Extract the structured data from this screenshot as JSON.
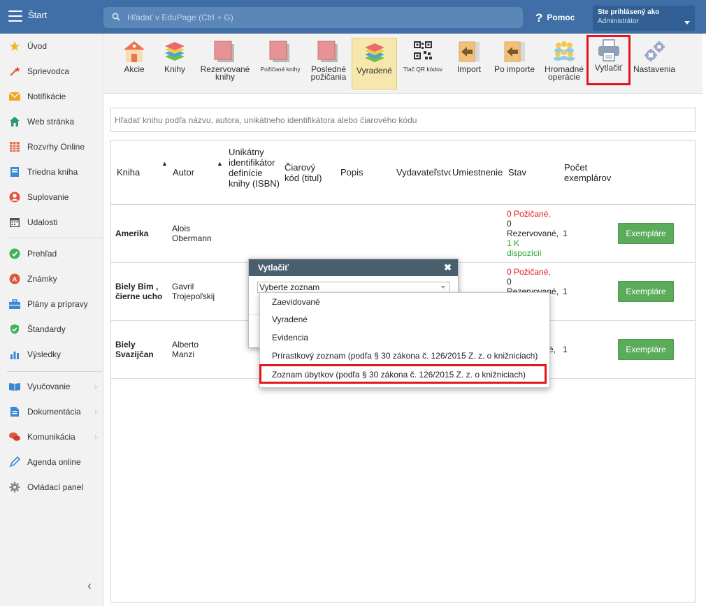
{
  "topbar": {
    "app_title": "Štart",
    "search_placeholder": "Hľadať v EduPage (Ctrl + G)",
    "help_label": "Pomoc",
    "user_line1": "Ste prihlásený ako",
    "user_line2": "Administrátor"
  },
  "sidebar": {
    "items": [
      {
        "label": "Úvod",
        "icon": "star-icon"
      },
      {
        "label": "Sprievodca",
        "icon": "wand-icon"
      },
      {
        "label": "Notifikácie",
        "icon": "envelope-icon"
      },
      {
        "label": "Web stránka",
        "icon": "house-icon"
      },
      {
        "label": "Rozvrhy Online",
        "icon": "timetable-icon"
      },
      {
        "label": "Triedna kniha",
        "icon": "book-icon"
      },
      {
        "label": "Suplovanie",
        "icon": "person-icon"
      },
      {
        "label": "Udalosti",
        "icon": "calendar-icon"
      },
      {
        "label": "Prehľad",
        "icon": "check-circle-icon"
      },
      {
        "label": "Známky",
        "icon": "grade-icon"
      },
      {
        "label": "Plány a prípravy",
        "icon": "briefcase-icon"
      },
      {
        "label": "Štandardy",
        "icon": "shield-icon"
      },
      {
        "label": "Výsledky",
        "icon": "bar-chart-icon"
      },
      {
        "label": "Vyučovanie",
        "icon": "open-book-icon"
      },
      {
        "label": "Dokumentácia",
        "icon": "document-icon"
      },
      {
        "label": "Komunikácia",
        "icon": "chat-icon"
      },
      {
        "label": "Agenda online",
        "icon": "pen-icon"
      },
      {
        "label": "Ovládací panel",
        "icon": "gear-icon"
      }
    ],
    "collapse_label": "‹"
  },
  "toolbar": {
    "items": [
      {
        "label": "Akcie",
        "icon": "building-icon"
      },
      {
        "label": "Knihy",
        "icon": "books-stack-icon"
      },
      {
        "label": "Rezervované knihy",
        "icon": "pink-book-icon"
      },
      {
        "label": "Požičané knihy",
        "icon": "pink-book-icon"
      },
      {
        "label": "Posledné požičania",
        "icon": "pink-book-icon"
      },
      {
        "label": "Vyradené",
        "icon": "books-stack-icon"
      },
      {
        "label": "Tlač QR kódov",
        "icon": "qr-code-icon"
      },
      {
        "label": "Import",
        "icon": "import-arrow-icon"
      },
      {
        "label": "Po importe",
        "icon": "import-arrow-icon"
      },
      {
        "label": "Hromadné operácie",
        "icon": "people-icon"
      },
      {
        "label": "Vytlačiť",
        "icon": "printer-icon"
      },
      {
        "label": "Nastavenia",
        "icon": "gears-icon"
      }
    ]
  },
  "book_search": {
    "placeholder": "Hľadať knihu podľa názvu, autora, unikátneho identifikátora alebo čiarového kódu"
  },
  "table": {
    "headers": {
      "kniha": "Kniha",
      "autor": "Autor",
      "isbn": "Unikátny identifikátor definície knihy (ISBN)",
      "barcode": "Čiarový kód (titul)",
      "popis": "Popis",
      "vydavatelstvo": "Vydavateľstvo",
      "umiestnenie": "Umiestnenie",
      "stav": "Stav",
      "pocet": "Počet exemplárov"
    },
    "rows": [
      {
        "title": "Amerika",
        "author": "Alois Obermann",
        "stav_borrowed": "0 Požičané,",
        "stav_reserved_count": "0",
        "stav_reserved": "Rezervované,",
        "stav_available": "1 K dispozícii",
        "count": "1",
        "button": "Exempláre"
      },
      {
        "title": "Biely Bim , čierne ucho",
        "author": "Gavril Trojepoľskij",
        "stav_borrowed": "0 Požičané,",
        "stav_reserved_count": "0",
        "stav_reserved": "Rezervované,",
        "count": "1",
        "button": "Exempláre"
      },
      {
        "title": "Biely Svazijčan",
        "author": "Alberto Manzi",
        "stav_reserved_tail": "é,",
        "count": "1",
        "button": "Exempláre"
      }
    ]
  },
  "dialog": {
    "title": "Vytlačiť",
    "select_value": "Vyberte zoznam",
    "options": [
      "Zaevidované",
      "Vyradené",
      "Evidencia",
      "Prírastkový zoznam (podľa § 30 zákona č. 126/2015 Z. z. o knižniciach)",
      "Zoznam úbytkov (podľa § 30 zákona č. 126/2015 Z. z. o knižniciach)"
    ]
  },
  "colors": {
    "topbar": "#3f6fa6",
    "highlight_red": "#e4161c",
    "active_tab": "#f6e7ad",
    "button_green": "#5aac5a"
  }
}
